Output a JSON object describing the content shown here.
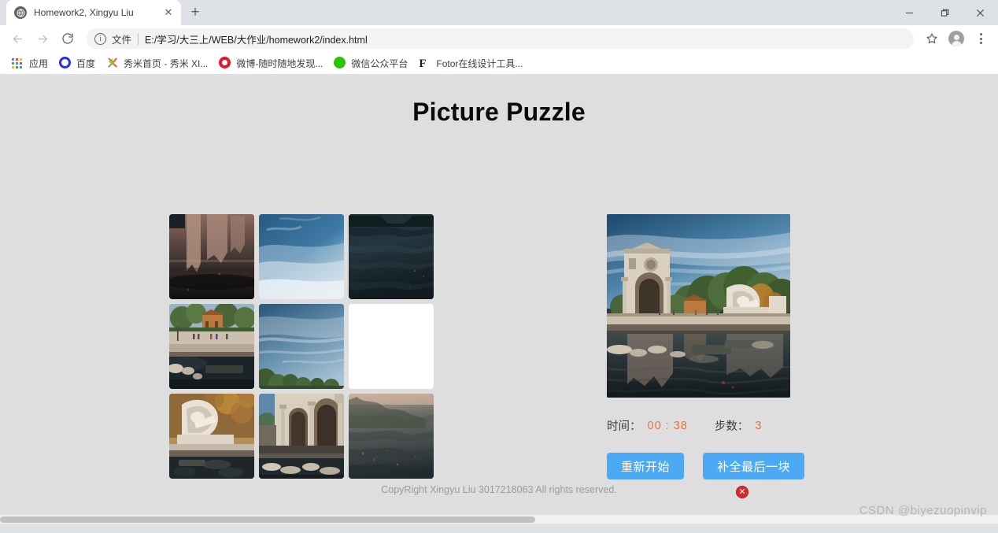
{
  "browser": {
    "tab": {
      "title": "Homework2, Xingyu Liu",
      "favicon": "globe-icon",
      "close": "✕"
    },
    "new_tab_label": "+",
    "window_controls": {
      "minimize": "minimize-icon",
      "maximize": "maximize-icon",
      "close": "close-icon"
    },
    "nav": {
      "back": "←",
      "forward": "→",
      "reload": "⟳"
    },
    "omnibox": {
      "info_icon": "i",
      "scheme_label": "文件",
      "url": "E:/学习/大三上/WEB/大作业/homework2/index.html"
    },
    "toolbar_right": {
      "bookmark_star": "☆",
      "profile": "avatar-icon",
      "menu": "kebab-menu-icon"
    },
    "bookmarks": [
      {
        "label": "应用",
        "icon": "apps-grid-icon"
      },
      {
        "label": "百度",
        "icon": "baidu-icon"
      },
      {
        "label": "秀米首页 - 秀米 XI...",
        "icon": "xiumi-icon"
      },
      {
        "label": "微博-随时随地发现...",
        "icon": "weibo-icon"
      },
      {
        "label": "微信公众平台",
        "icon": "wechat-icon"
      },
      {
        "label": "Fotor在线设计工具...",
        "icon": "fotor-icon"
      }
    ]
  },
  "page": {
    "title": "Picture Puzzle",
    "footer": "CopyRight Xingyu Liu 3017218063 All rights reserved.",
    "background_color": "#dedede"
  },
  "puzzle": {
    "rows": 3,
    "cols": 3,
    "blank_index": 5,
    "tiles": [
      {
        "index": 0,
        "name": "tile-reflection-building",
        "blank": false
      },
      {
        "index": 1,
        "name": "tile-blue-sky-clouds",
        "blank": false
      },
      {
        "index": 2,
        "name": "tile-dark-water",
        "blank": false
      },
      {
        "index": 3,
        "name": "tile-campus-trees-plaza",
        "blank": false
      },
      {
        "index": 4,
        "name": "tile-sky-with-treetops",
        "blank": false
      },
      {
        "index": 5,
        "name": "tile-empty-slot",
        "blank": true
      },
      {
        "index": 6,
        "name": "tile-stone-sculpture",
        "blank": false
      },
      {
        "index": 7,
        "name": "tile-stone-archway",
        "blank": false
      },
      {
        "index": 8,
        "name": "tile-water-reflection-trees",
        "blank": false
      }
    ]
  },
  "preview": {
    "name": "reference-image",
    "alt": "Campus plaza with stone archway, sculpture and reflecting pool"
  },
  "status": {
    "time_label": "时间：",
    "time_value": "00 : 38",
    "steps_label": "步数：",
    "steps_value": "3",
    "value_color": "#e8733a"
  },
  "controls": {
    "restart_label": "重新开始",
    "complete_label": "补全最后一块",
    "button_color": "#4caaf5",
    "error_mark": "✕",
    "error_color": "#d7272c"
  },
  "watermark": "CSDN @biyezuopinvip"
}
